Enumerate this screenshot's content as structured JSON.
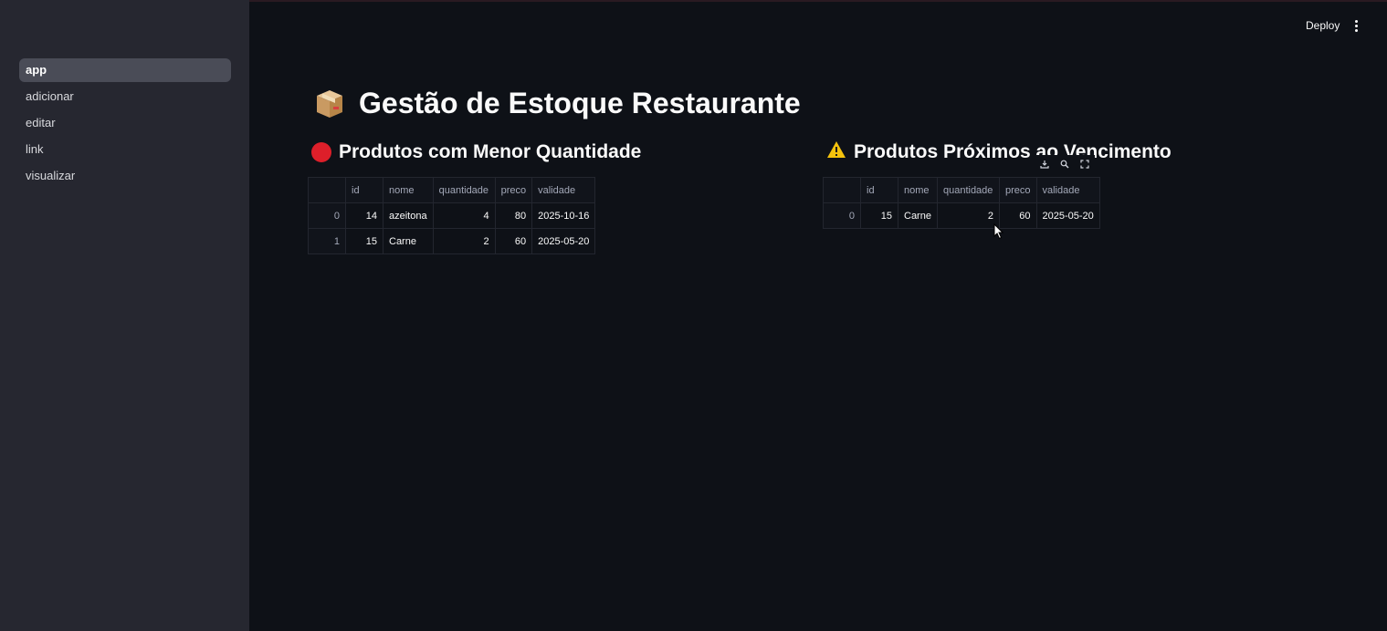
{
  "sidebar": {
    "items": [
      {
        "label": "app",
        "active": true
      },
      {
        "label": "adicionar",
        "active": false
      },
      {
        "label": "editar",
        "active": false
      },
      {
        "label": "link",
        "active": false
      },
      {
        "label": "visualizar",
        "active": false
      }
    ]
  },
  "header": {
    "deploy_label": "Deploy",
    "menu_icon": "more-vertical-icon"
  },
  "main": {
    "title": "Gestão de Estoque Restaurante",
    "title_icon": "package-box-icon",
    "low_stock": {
      "heading": "Produtos com Menor Quantidade",
      "icon": "red-circle-icon",
      "columns": [
        "",
        "id",
        "nome",
        "quantidade",
        "preco",
        "validade"
      ],
      "rows": [
        {
          "index": "0",
          "id": "14",
          "nome": "azeitona",
          "quantidade": "4",
          "preco": "80",
          "validade": "2025-10-16"
        },
        {
          "index": "1",
          "id": "15",
          "nome": "Carne",
          "quantidade": "2",
          "preco": "60",
          "validade": "2025-05-20"
        }
      ]
    },
    "expiring": {
      "heading": "Produtos Próximos ao Vencimento",
      "icon": "warning-icon",
      "columns": [
        "",
        "id",
        "nome",
        "quantidade",
        "preco",
        "validade"
      ],
      "rows": [
        {
          "index": "0",
          "id": "15",
          "nome": "Carne",
          "quantidade": "2",
          "preco": "60",
          "validade": "2025-05-20"
        }
      ]
    },
    "table_toolbar": [
      "download-icon",
      "search-icon",
      "fullscreen-icon"
    ]
  },
  "colors": {
    "background": "#0e1117",
    "sidebar": "#262730",
    "active_nav": "#4a4c57",
    "red": "#dd1f2a",
    "warning": "#f4c20d"
  }
}
